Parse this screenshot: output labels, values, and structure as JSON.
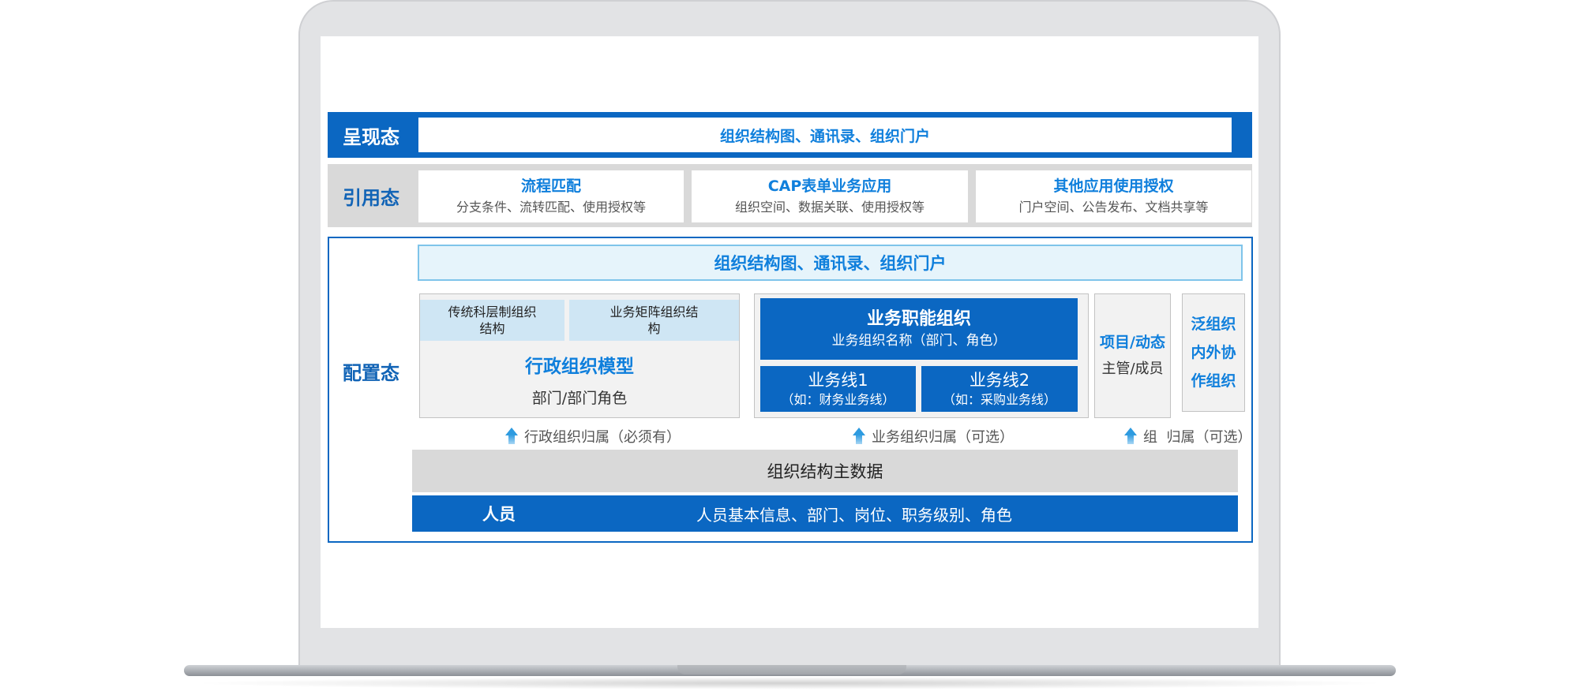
{
  "presentation": {
    "label": "呈现态",
    "content": "组织结构图、通讯录、组织门户"
  },
  "reference": {
    "label": "引用态",
    "cards": [
      {
        "title": "流程匹配",
        "subtitle": "分支条件、流转匹配、使用授权等"
      },
      {
        "title": "CAP表单业务应用",
        "subtitle": "组织空间、数据关联、使用授权等"
      },
      {
        "title": "其他应用使用授权",
        "subtitle": "门户空间、公告发布、文档共享等"
      }
    ]
  },
  "configuration": {
    "label": "配置态",
    "banner": "组织结构图、通讯录、组织门户",
    "admin_model": {
      "tile1": "传统科层制组织结构",
      "tile2": "业务矩阵组织结构",
      "title": "行政组织模型",
      "subtitle": "部门/部门角色"
    },
    "business": {
      "title": "业务职能组织",
      "subtitle": "业务组织名称（部门、角色）",
      "line1_title": "业务线1",
      "line1_sub": "（如：财务业务线）",
      "line2_title": "业务线2",
      "line2_sub": "（如：采购业务线）"
    },
    "project": {
      "title": "项目/动态",
      "subtitle": "主管/成员"
    },
    "pan": {
      "line1": "泛组织",
      "line2": "内外协",
      "line3": "作组织"
    },
    "arrows": {
      "admin": "行政组织归属（必须有）",
      "business": "业务组织归属（可选）",
      "group": "组  归属（可选）"
    },
    "master_data": "组织结构主数据",
    "people": {
      "label": "人员",
      "desc": "人员基本信息、部门、岗位、职务级别、角色"
    }
  },
  "colors": {
    "primary": "#0b67c2",
    "accent": "#0f7fdc",
    "light": "#e6f4fb",
    "gray": "#d9d9d9"
  }
}
